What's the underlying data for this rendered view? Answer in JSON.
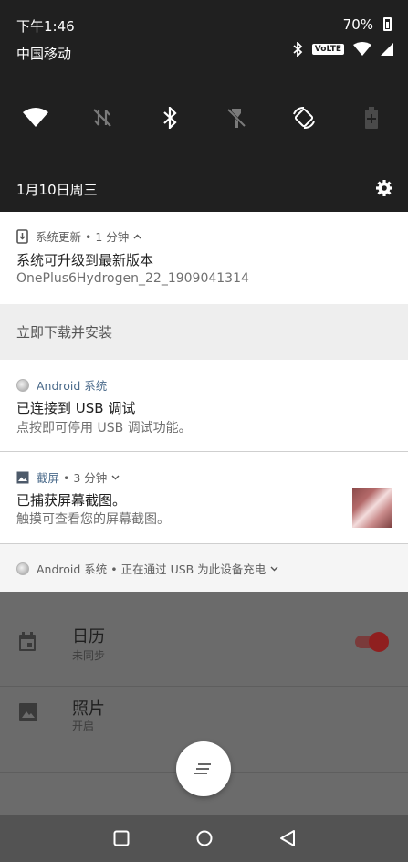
{
  "status_bar": {
    "time": "下午1:46",
    "battery": "70%",
    "carrier": "中国移动",
    "volte": "VoLTE"
  },
  "quick_settings": {
    "date": "1月10日周三",
    "tiles": [
      "wifi-icon",
      "mobile-data-off-icon",
      "bluetooth-icon",
      "flashlight-off-icon",
      "auto-rotate-icon",
      "battery-saver-icon"
    ]
  },
  "notifications": {
    "update": {
      "app": "系统更新",
      "time": "• 1 分钟",
      "title": "系统可升级到最新版本",
      "text": "OnePlus6Hydrogen_22_1909041314",
      "action": "立即下载并安装"
    },
    "usb_debug": {
      "app": "Android 系统",
      "title": "已连接到 USB 调试",
      "text": "点按即可停用 USB 调试功能。"
    },
    "screenshot": {
      "app": "截屏",
      "time": "• 3 分钟",
      "title": "已捕获屏幕截图。",
      "text": "触摸可查看您的屏幕截图。"
    },
    "charging": {
      "text": "Android 系统 • 正在通过 USB 为此设备充电"
    }
  },
  "background_app": {
    "rows": [
      {
        "title": "日历",
        "subtitle": "未同步"
      },
      {
        "title": "照片",
        "subtitle": "开启"
      }
    ]
  },
  "colors": {
    "shade": "#202020",
    "accent_toggle": "#8f1f1f",
    "app_link": "#4a6a8a"
  }
}
